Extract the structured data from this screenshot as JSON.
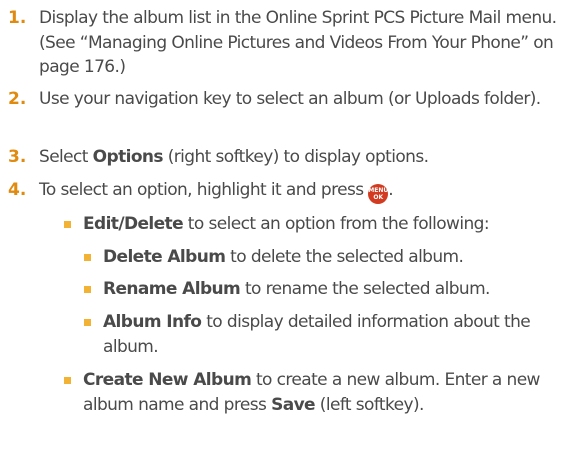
{
  "steps": [
    {
      "number": "1.",
      "text": "Display the album list in the Online Sprint PCS Picture Mail menu. (See “Managing Online Pictures and Videos From Your Phone” on page 176.)"
    },
    {
      "number": "2.",
      "text": "Use your navigation key to select an album (or Uploads folder)."
    },
    {
      "number": "3.",
      "bold": "Options",
      "text": " (right softkey) to display options.",
      "prefix": "Select "
    },
    {
      "number": "4.",
      "text": "To select an option, highlight it and press ",
      "key": {
        "icon": "menu-ok-key-icon",
        "line1": "MENU",
        "line2": "OK",
        "color": "#d23b20"
      },
      "suffix": "."
    }
  ],
  "options": [
    {
      "bold": "Edit/Delete",
      "text": " to select an option from the following:"
    },
    {
      "bold": "Delete Album",
      "text": " to delete the selected album."
    },
    {
      "bold": "Rename Album",
      "text": " to rename the selected album."
    },
    {
      "bold": "Album Info",
      "text": " to display detailed information about the album."
    },
    {
      "bold": "Create New Album",
      "text": " to create a new album. Enter a new album name and press ",
      "bold2": "Save",
      "text2": " (left softkey)."
    }
  ],
  "colors": {
    "step_number": "#e08b0f",
    "bullet": "#f2b233",
    "text": "#4a4a4a"
  }
}
